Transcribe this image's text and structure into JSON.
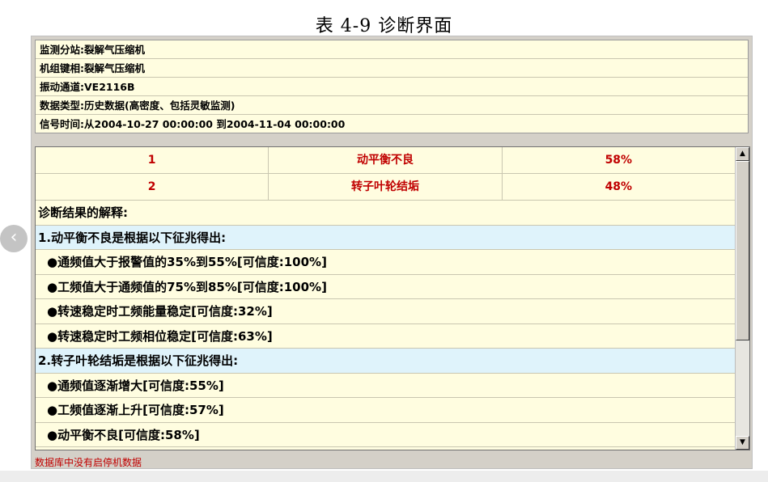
{
  "caption": "表 4-9  诊断界面",
  "info": [
    "监测分站:裂解气压缩机",
    "机组键相:裂解气压缩机",
    "振动通道:VE2116B",
    "数据类型:历史数据(高密度、包括灵敏监测)",
    "信号时间:从2004-10-27  00:00:00  到2004-11-04  00:00:00"
  ],
  "results": [
    {
      "index": "1",
      "fault": "动平衡不良",
      "probability": "58%"
    },
    {
      "index": "2",
      "fault": "转子叶轮结垢",
      "probability": "48%"
    }
  ],
  "explanation_header": "诊断结果的解释:",
  "causes": [
    {
      "title": "1.动平衡不良是根据以下征兆得出:",
      "symptoms": [
        "●通频值大于报警值的35%到55%[可信度:100%]",
        "●工频值大于通频值的75%到85%[可信度:100%]",
        "●转速稳定时工频能量稳定[可信度:32%]",
        "●转速稳定时工频相位稳定[可信度:63%]"
      ]
    },
    {
      "title": "2.转子叶轮结垢是根据以下征兆得出:",
      "symptoms": [
        "●通频值逐渐增大[可信度:55%]",
        "●工频值逐渐上升[可信度:57%]",
        "●动平衡不良[可信度:58%]"
      ]
    }
  ],
  "status_text": "数据库中没有启停机数据",
  "icons": {
    "nav": "chevron-left-icon",
    "scroll_up": "arrow-up-icon",
    "scroll_down": "arrow-down-icon"
  },
  "colors": {
    "panel_bg": "#fffde0",
    "cause_bg": "#dff3fb",
    "alert_text": "#c00000"
  }
}
